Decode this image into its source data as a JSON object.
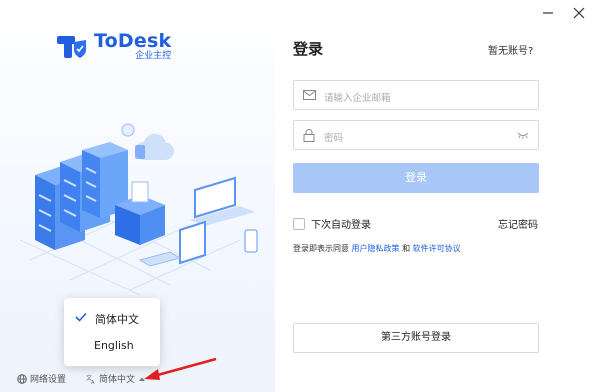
{
  "brand": {
    "name": "ToDesk",
    "subtitle": "企业主控"
  },
  "window": {
    "minimize_icon": "minimize-icon",
    "close_icon": "close-icon"
  },
  "login": {
    "title": "登录",
    "no_account": "暂无账号?",
    "email": {
      "placeholder": "请输入企业邮箱",
      "icon": "mail-icon"
    },
    "password": {
      "placeholder": "密码",
      "icon": "lock-icon",
      "toggle_icon": "eye-closed-icon"
    },
    "submit_label": "登录",
    "remember_label": "下次自动登录",
    "forgot_label": "忘记密码",
    "agreement": {
      "prefix": "登录即表示同意",
      "privacy": "用户隐私政策",
      "and": "和",
      "license": "软件许可协议"
    },
    "third_party_label": "第三方账号登录"
  },
  "language_menu": {
    "items": [
      {
        "label": "简体中文",
        "selected": true
      },
      {
        "label": "English",
        "selected": false
      }
    ]
  },
  "footer": {
    "network_label": "网络设置",
    "language_label": "简体中文"
  },
  "colors": {
    "brand": "#1f5fe0",
    "button_disabled": "#a8c7f7",
    "arrow": "#e02020"
  }
}
